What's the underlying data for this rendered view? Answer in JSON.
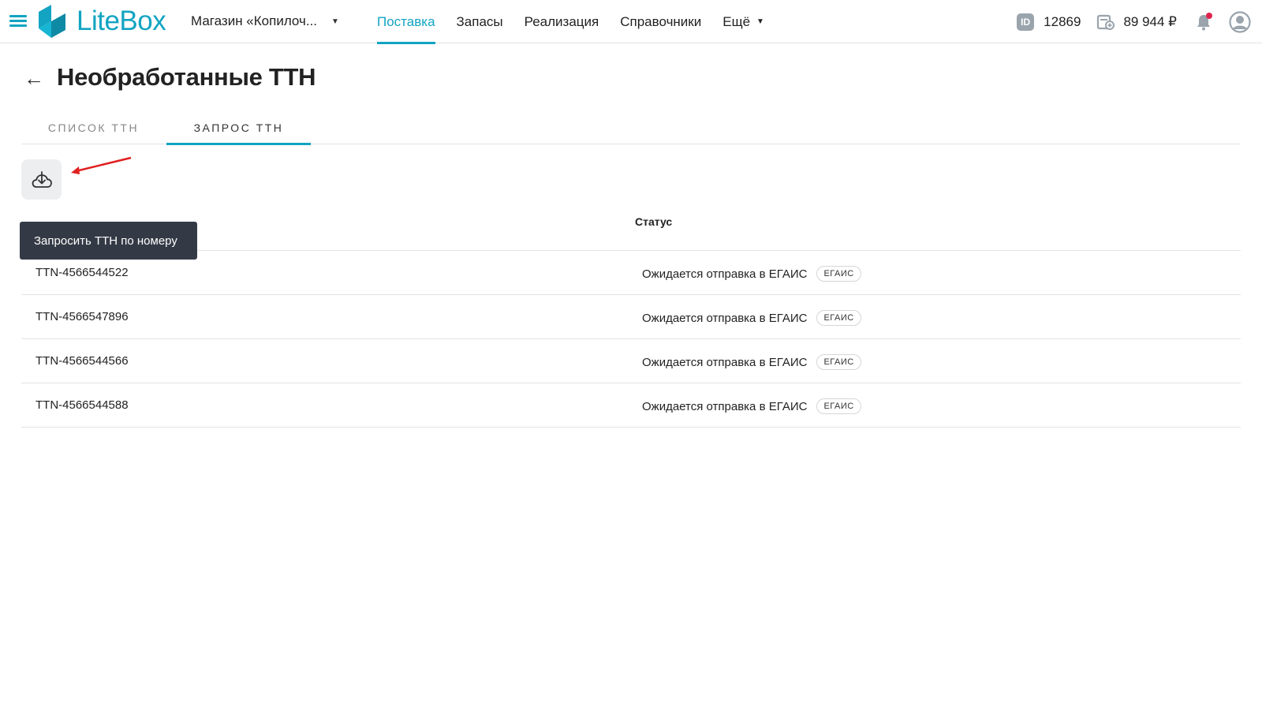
{
  "header": {
    "logo_text": "LiteBox",
    "store_name": "Магазин «Копилоч...",
    "nav": [
      {
        "label": "Поставка",
        "active": true
      },
      {
        "label": "Запасы"
      },
      {
        "label": "Реализация"
      },
      {
        "label": "Справочники"
      },
      {
        "label": "Ещё"
      }
    ],
    "id_badge": "ID",
    "id_value": "12869",
    "balance": "89 944 ₽",
    "accent_color": "#12a4c2",
    "notification_dot_color": "#e0234d"
  },
  "page": {
    "title": "Необработанные ТТН",
    "tabs": [
      {
        "label": "СПИСОК ТТН"
      },
      {
        "label": "ЗАПРОС ТТН",
        "active": true
      }
    ],
    "action_icon": "cloud-download-icon",
    "tooltip": "Запросить ТТН по номеру"
  },
  "table": {
    "status_header": "Статус",
    "rows": [
      {
        "number": "TTN-4566544522",
        "status": "Ожидается отправка в ЕГАИС",
        "tag": "ЕГАИС"
      },
      {
        "number": "TTN-4566547896",
        "status": "Ожидается отправка в ЕГАИС",
        "tag": "ЕГАИС"
      },
      {
        "number": "TTN-4566544566",
        "status": "Ожидается отправка в ЕГАИС",
        "tag": "ЕГАИС"
      },
      {
        "number": "TTN-4566544588",
        "status": "Ожидается отправка в ЕГАИС",
        "tag": "ЕГАИС"
      }
    ]
  }
}
